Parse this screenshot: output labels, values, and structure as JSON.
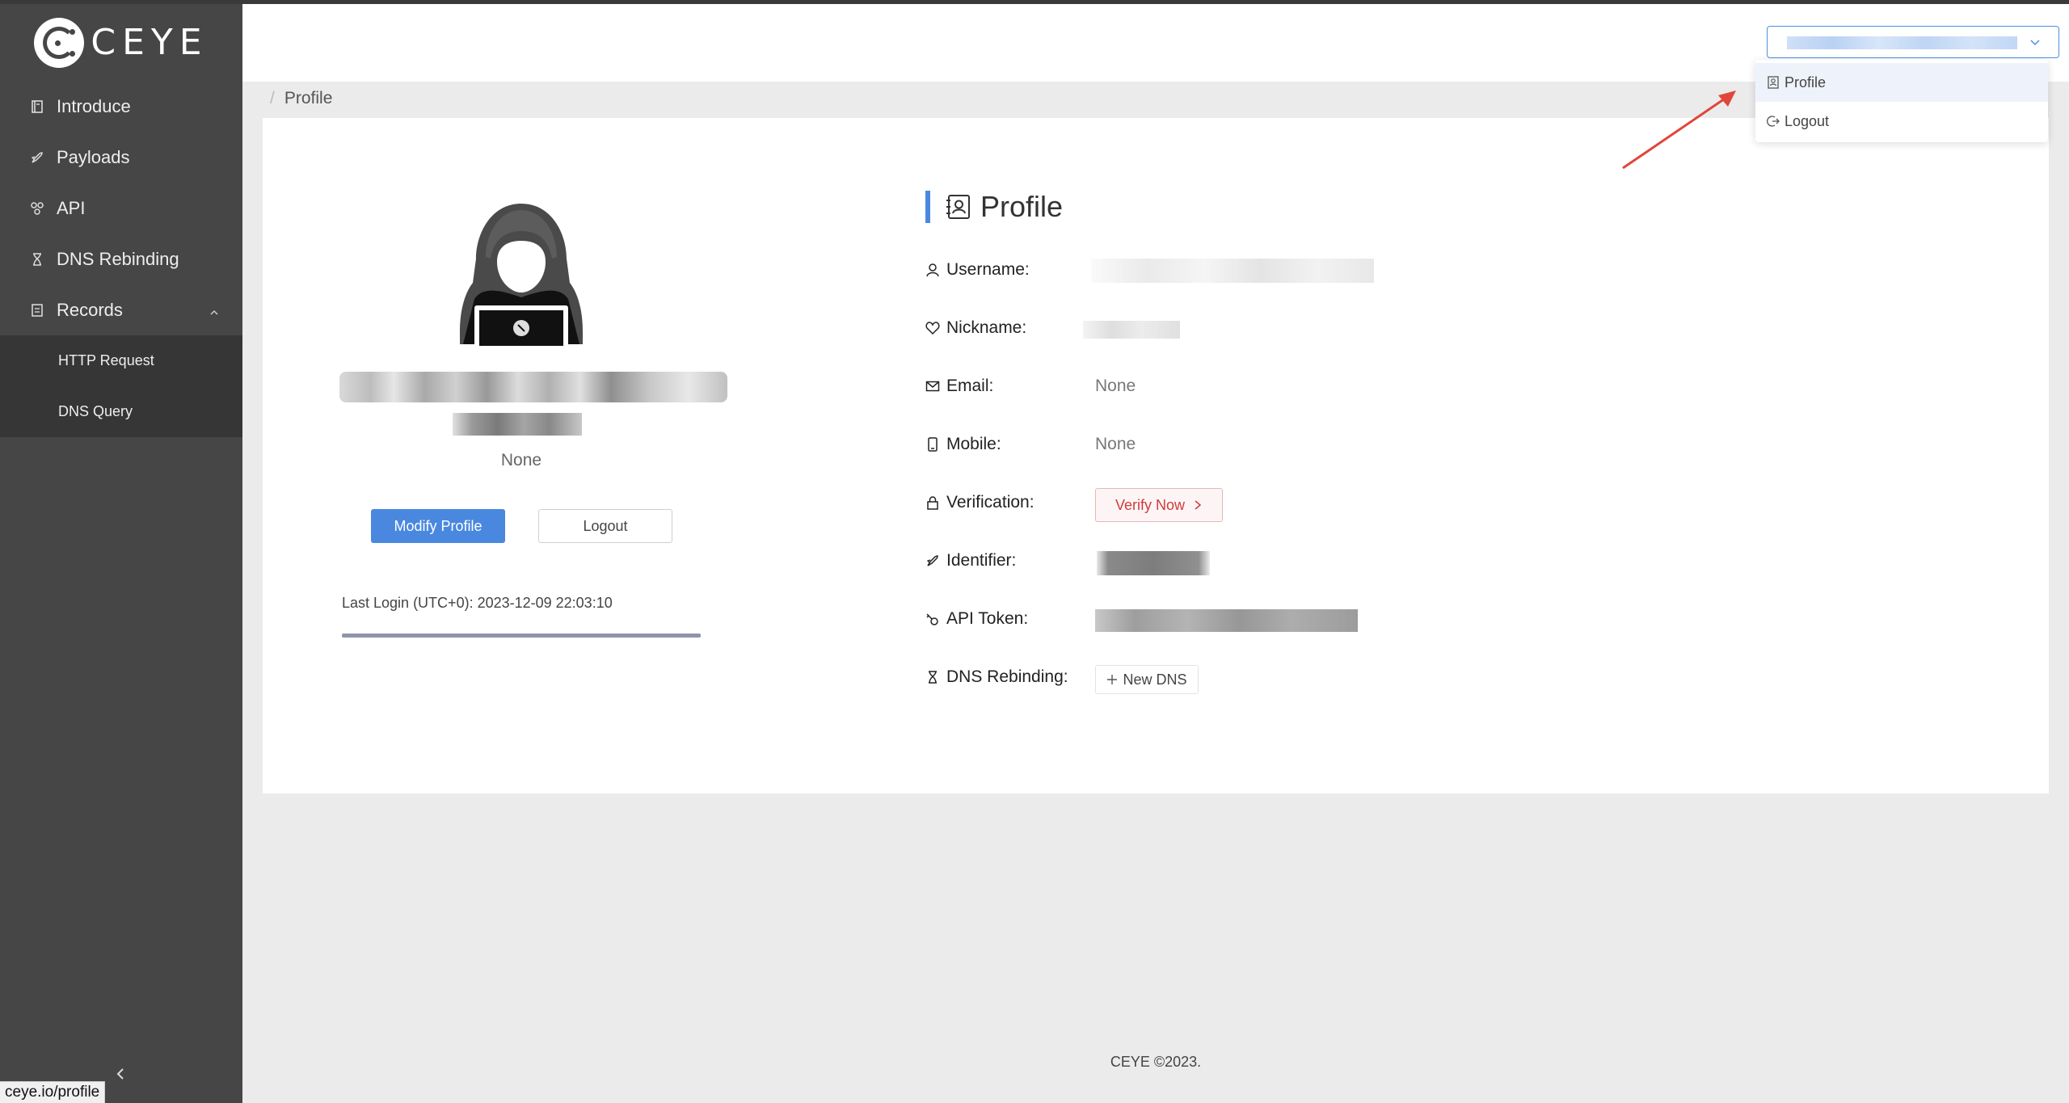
{
  "app": {
    "logo_text": "CEYE"
  },
  "sidebar": {
    "items": [
      {
        "label": "Introduce",
        "icon": "book-icon"
      },
      {
        "label": "Payloads",
        "icon": "rocket-icon"
      },
      {
        "label": "API",
        "icon": "api-icon"
      },
      {
        "label": "DNS Rebinding",
        "icon": "hourglass-icon"
      },
      {
        "label": "Records",
        "icon": "document-icon",
        "expanded": true
      }
    ],
    "sub_items": [
      {
        "label": "HTTP Request"
      },
      {
        "label": "DNS Query"
      }
    ]
  },
  "status_url": "ceye.io/profile",
  "header": {
    "dropdown": [
      {
        "label": "Profile",
        "icon": "profile-icon",
        "active": true
      },
      {
        "label": "Logout",
        "icon": "logout-icon"
      }
    ]
  },
  "breadcrumb": {
    "separator": "/",
    "current": "Profile"
  },
  "left_panel": {
    "none_text": "None",
    "modify_button": "Modify Profile",
    "logout_button": "Logout",
    "last_login": "Last Login (UTC+0): 2023-12-09 22:03:10"
  },
  "profile": {
    "title": "Profile",
    "fields": {
      "username_label": "Username:",
      "nickname_label": "Nickname:",
      "email_label": "Email:",
      "email_value": "None",
      "mobile_label": "Mobile:",
      "mobile_value": "None",
      "verification_label": "Verification:",
      "verify_button": "Verify Now",
      "identifier_label": "Identifier:",
      "api_token_label": "API Token:",
      "dns_rebinding_label": "DNS Rebinding:",
      "new_dns_button": "New DNS"
    }
  },
  "footer": {
    "text": "CEYE ©2023."
  },
  "colors": {
    "accent": "#4a88e0",
    "sidebar_bg": "#464646",
    "danger": "#d23b3b"
  }
}
